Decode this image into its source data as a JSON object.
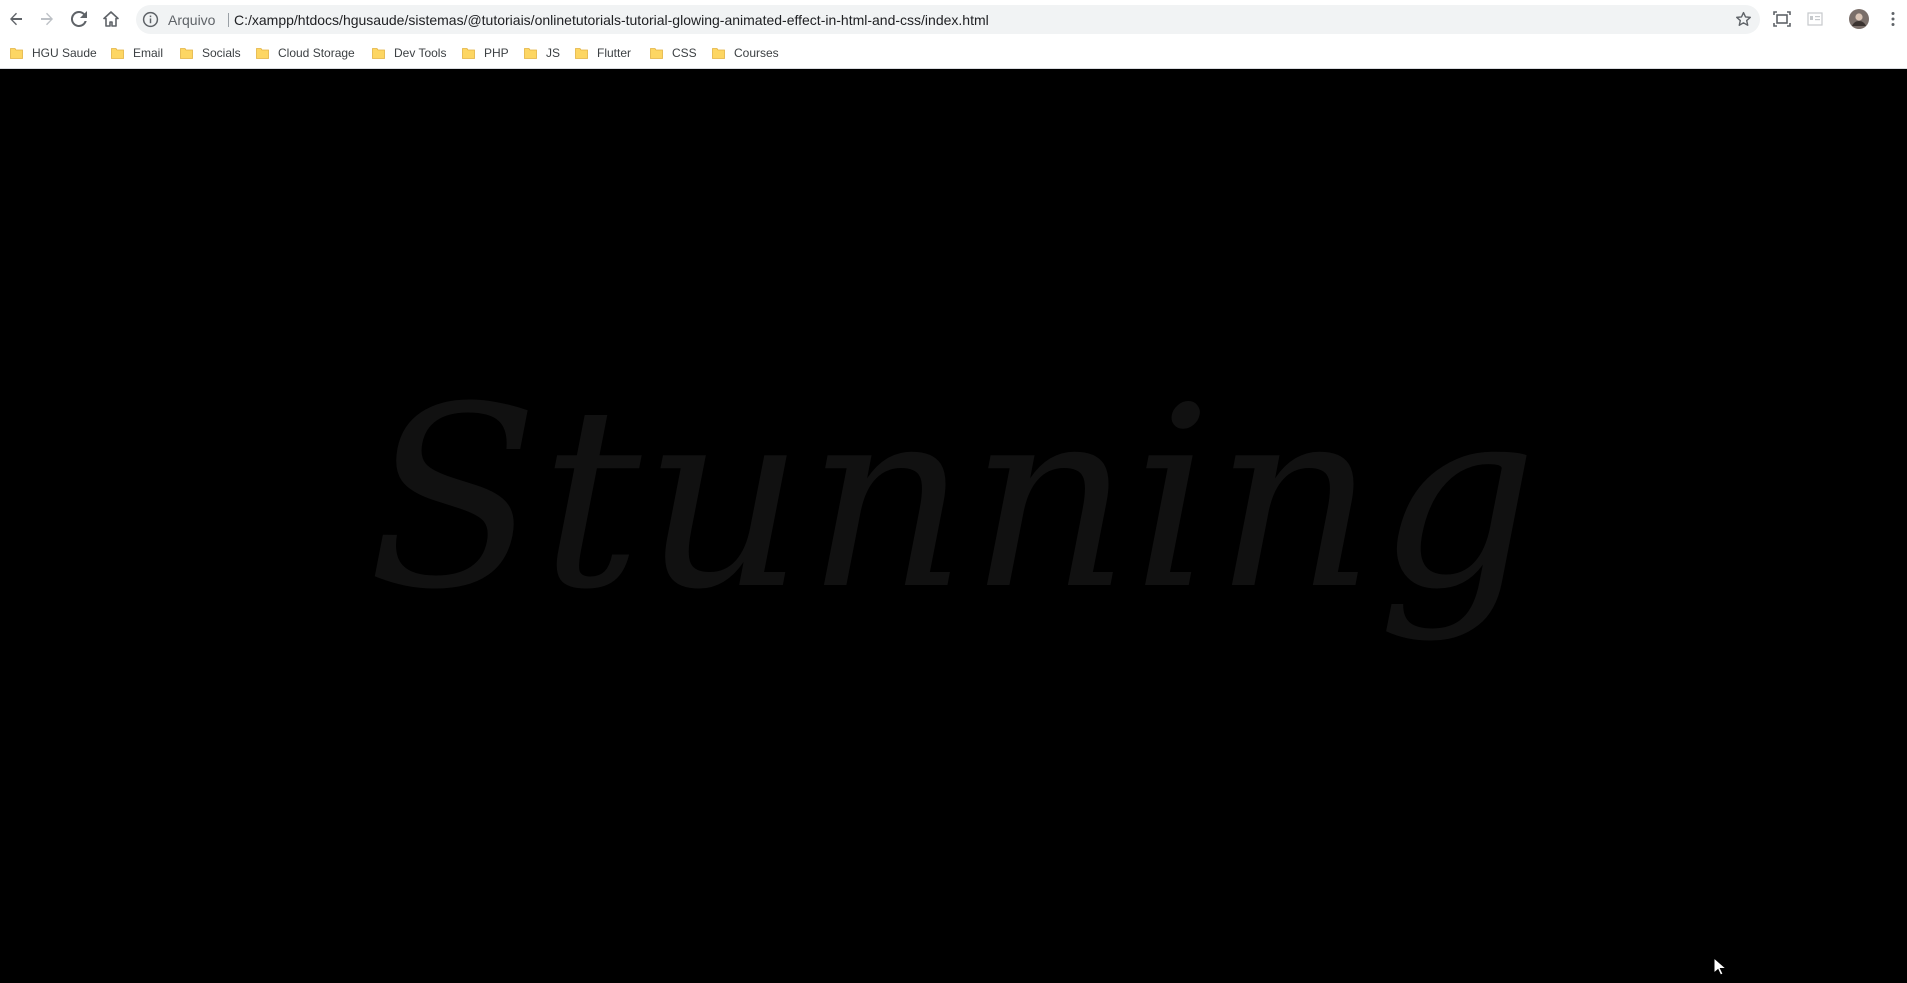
{
  "browser": {
    "origin_label": "Arquivo",
    "url": "C:/xampp/htdocs/hgusaude/sistemas/@tutoriais/onlinetutorials-tutorial-glowing-animated-effect-in-html-and-css/index.html",
    "icons": {
      "back": "back-arrow-icon",
      "forward": "forward-arrow-icon",
      "reload": "reload-icon",
      "home": "home-icon",
      "info": "info-icon",
      "bookmark_star": "star-icon",
      "screenshot": "capture-icon",
      "extension": "extension-icon",
      "profile": "avatar",
      "menu": "kebab-menu-icon"
    }
  },
  "bookmarks": [
    {
      "label": "HGU Saude"
    },
    {
      "label": "Email"
    },
    {
      "label": "Socials"
    },
    {
      "label": "Cloud Storage"
    },
    {
      "label": "Dev Tools"
    },
    {
      "label": "PHP"
    },
    {
      "label": "JS"
    },
    {
      "label": "Flutter"
    },
    {
      "label": "CSS"
    },
    {
      "label": "Courses"
    }
  ],
  "page": {
    "heading": "Stunning",
    "background_color": "#000000",
    "text_color": "#111111"
  },
  "colors": {
    "folder": "#fdd663",
    "folder_border": "#e3b341",
    "omnibox_bg": "#f1f3f4"
  }
}
